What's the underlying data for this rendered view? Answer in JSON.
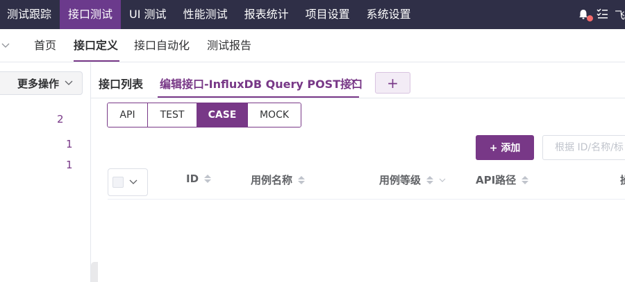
{
  "topnav": {
    "items": [
      "测试跟踪",
      "接口测试",
      "UI 测试",
      "性能测试",
      "报表统计",
      "项目设置",
      "系统设置"
    ],
    "active_index": 1,
    "user_name": "飞"
  },
  "subnav": {
    "items": [
      "首页",
      "接口定义",
      "接口自动化",
      "测试报告"
    ],
    "active_index": 1
  },
  "leftpane": {
    "more_actions": "更多操作",
    "counts": [
      "2",
      "1",
      "1"
    ]
  },
  "tabs": {
    "list_label": "接口列表",
    "edit_label": "编辑接口-InfluxDB Query POST接口",
    "close_glyph": "×",
    "add_glyph": "+"
  },
  "segments": {
    "items": [
      "API",
      "TEST",
      "CASE",
      "MOCK"
    ],
    "active_index": 2
  },
  "toolbar": {
    "add_label": "+ 添加",
    "search_placeholder": "根据 ID/名称/标"
  },
  "table": {
    "columns": [
      "ID",
      "用例名称",
      "用例等级",
      "API路径",
      "操"
    ]
  },
  "colors": {
    "brand": "#783887",
    "topnav_bg": "#2f2f47",
    "badge": "#f56c6c"
  }
}
